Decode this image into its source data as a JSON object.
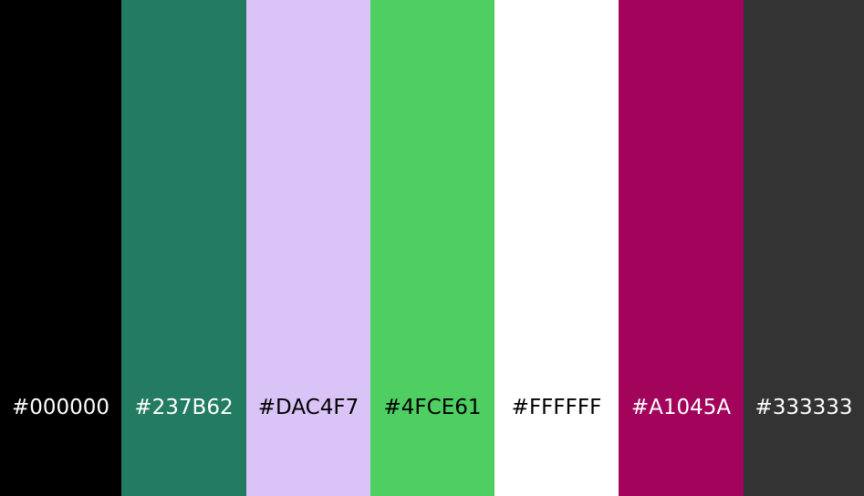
{
  "palette": {
    "swatches": [
      {
        "hex": "#000000",
        "color": "#000000",
        "label_color": "#ffffff"
      },
      {
        "hex": "#237B62",
        "color": "#237B62",
        "label_color": "#ffffff"
      },
      {
        "hex": "#DAC4F7",
        "color": "#DAC4F7",
        "label_color": "#000000"
      },
      {
        "hex": "#4FCE61",
        "color": "#4FCE61",
        "label_color": "#000000"
      },
      {
        "hex": "#FFFFFF",
        "color": "#FFFFFF",
        "label_color": "#000000"
      },
      {
        "hex": "#A1045A",
        "color": "#A1045A",
        "label_color": "#ffffff"
      },
      {
        "hex": "#333333",
        "color": "#333333",
        "label_color": "#ffffff"
      }
    ]
  }
}
